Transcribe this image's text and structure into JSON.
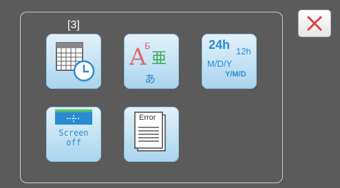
{
  "page_indicator": "[3]",
  "close_button": {
    "icon": "close-icon",
    "color": "#e63b3b"
  },
  "tiles": [
    {
      "name": "date-time-settings",
      "icon": "calendar-clock-icon"
    },
    {
      "name": "language-settings",
      "icon": "language-icon",
      "glyphs": {
        "latin": "A",
        "cyrillic": "Б",
        "cjk": "亜",
        "kana": "あ"
      }
    },
    {
      "name": "time-date-format",
      "icon": "time-format-icon",
      "labels": {
        "h24": "24h",
        "h12": "12h",
        "mdy": "M/D/Y",
        "ymd": "Y/M/D"
      }
    },
    {
      "name": "screen-off",
      "icon": "screen-off-icon",
      "labels": {
        "line1": "Screen",
        "line2": "off"
      }
    },
    {
      "name": "error-log",
      "icon": "error-document-icon",
      "labels": {
        "title": "Error"
      }
    }
  ],
  "colors": {
    "tile_gradient_top": "#e4f2fb",
    "tile_gradient_bottom": "#a9d3ee",
    "accent_blue": "#2a8bd0"
  }
}
